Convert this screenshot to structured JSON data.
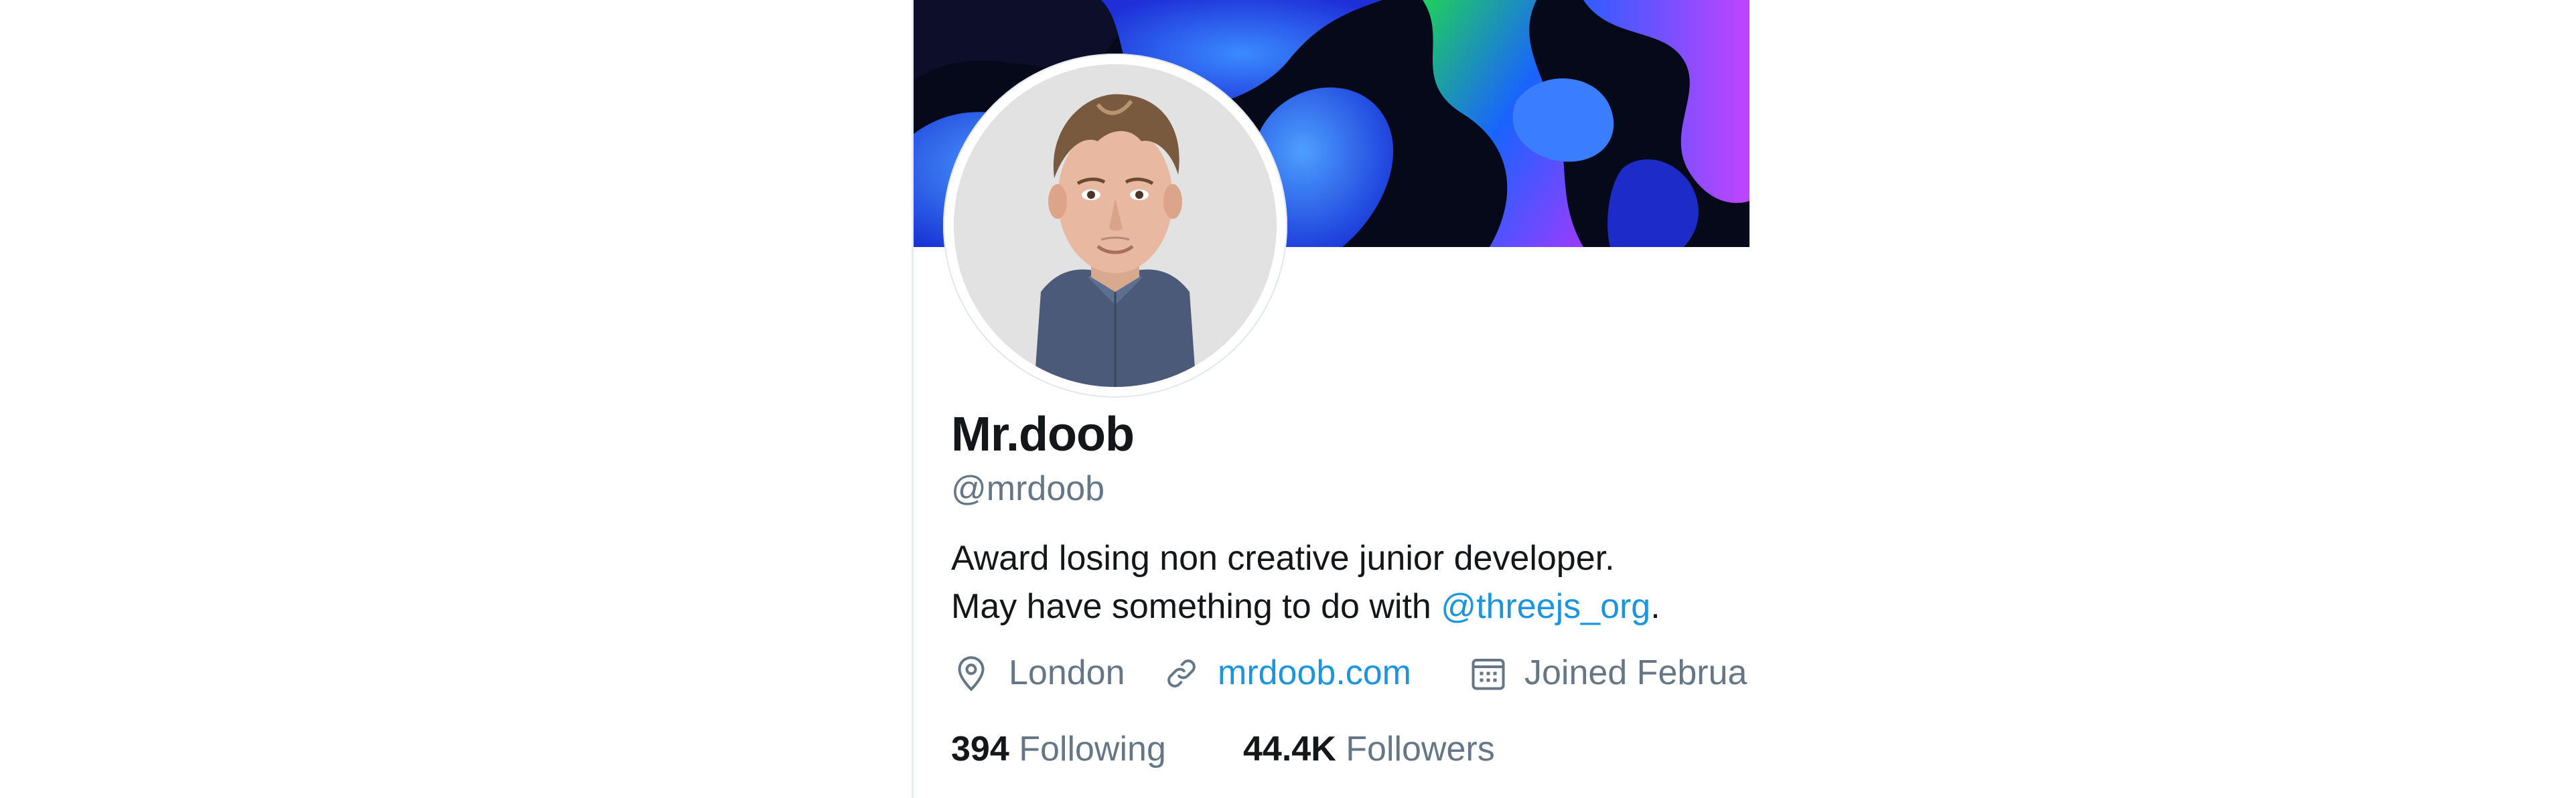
{
  "profile": {
    "display_name": "Mr.doob",
    "handle": "@mrdoob",
    "bio": {
      "line1": "Award losing non creative junior developer.",
      "line2_prefix": "May have something to do with ",
      "line2_mention": "@threejs_org",
      "line2_suffix": "."
    },
    "location": "London",
    "website": "mrdoob.com",
    "joined": "Joined Februa",
    "following": {
      "count": "394",
      "label": "Following"
    },
    "followers": {
      "count": "44.4K",
      "label": "Followers"
    }
  },
  "icons": {
    "location": "location-pin-icon",
    "website": "link-icon",
    "joined": "calendar-icon"
  },
  "colors": {
    "link": "#1b95e0",
    "secondary_text": "#657786",
    "primary_text": "#14171a",
    "border": "#e6ecf0"
  }
}
